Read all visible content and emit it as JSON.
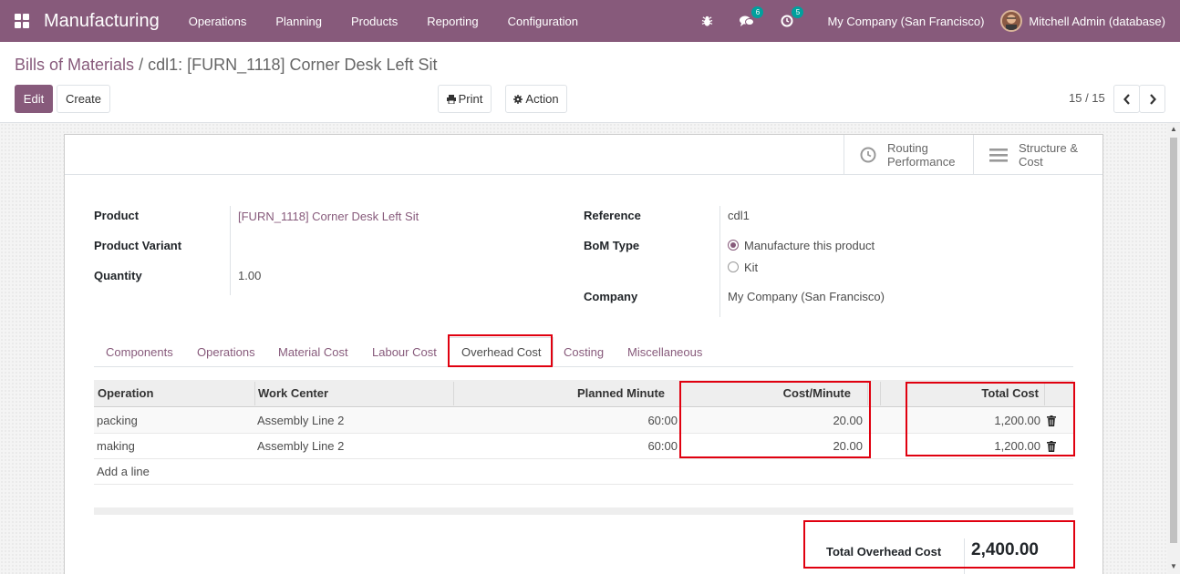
{
  "navbar": {
    "app_title": "Manufacturing",
    "menu": [
      "Operations",
      "Planning",
      "Products",
      "Reporting",
      "Configuration"
    ],
    "messages_count": "6",
    "activities_count": "5",
    "company": "My Company (San Francisco)",
    "user": "Mitchell Admin (database)"
  },
  "breadcrumb": {
    "parent": "Bills of Materials",
    "separator": "/",
    "current": "cdl1: [FURN_1118] Corner Desk Left Sit"
  },
  "toolbar": {
    "edit_label": "Edit",
    "create_label": "Create",
    "print_label": "Print",
    "action_label": "Action",
    "pager": "15 / 15"
  },
  "smart_buttons": {
    "routing_line1": "Routing",
    "routing_line2": "Performance",
    "structure_line1": "Structure &",
    "structure_line2": "Cost"
  },
  "form": {
    "product_label": "Product",
    "product_value": "[FURN_1118] Corner Desk Left Sit",
    "variant_label": "Product Variant",
    "quantity_label": "Quantity",
    "quantity_value": "1.00",
    "reference_label": "Reference",
    "reference_value": "cdl1",
    "bom_type_label": "BoM Type",
    "bom_type_option1": "Manufacture this product",
    "bom_type_option2": "Kit",
    "company_label": "Company",
    "company_value": "My Company (San Francisco)"
  },
  "tabs": [
    "Components",
    "Operations",
    "Material Cost",
    "Labour Cost",
    "Overhead Cost",
    "Costing",
    "Miscellaneous"
  ],
  "table": {
    "headers": [
      "Operation",
      "Work Center",
      "Planned Minute",
      "Cost/Minute",
      "Total Cost"
    ],
    "rows": [
      [
        "packing",
        "Assembly Line 2",
        "60:00",
        "20.00",
        "1,200.00"
      ],
      [
        "making",
        "Assembly Line 2",
        "60:00",
        "20.00",
        "1,200.00"
      ]
    ],
    "add_line": "Add a line"
  },
  "total": {
    "label": "Total Overhead Cost",
    "value": "2,400.00"
  },
  "colors": {
    "brand": "#875a7b",
    "highlight": "#e0000f",
    "badge": "#00a09d"
  }
}
